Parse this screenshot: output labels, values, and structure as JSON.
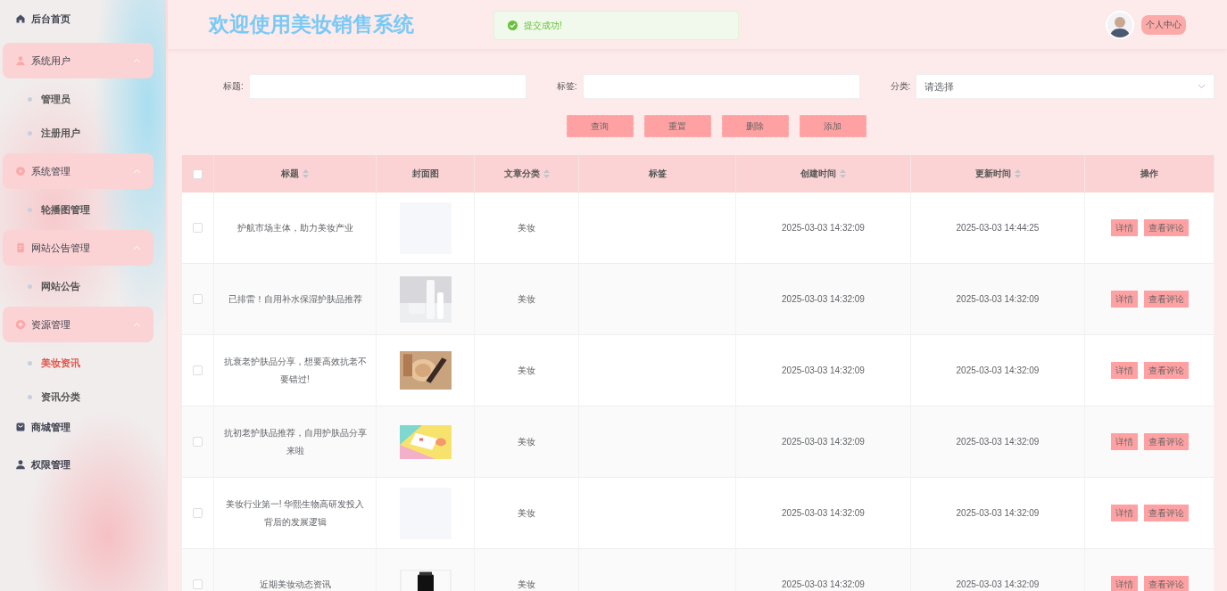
{
  "sidebar": {
    "items": [
      {
        "label": "后台首页",
        "expanded": false
      },
      {
        "label": "系统用户",
        "expanded": true,
        "children": [
          {
            "label": "管理员",
            "selected": false
          },
          {
            "label": "注册用户",
            "selected": false
          }
        ]
      },
      {
        "label": "系统管理",
        "expanded": true,
        "children": [
          {
            "label": "轮播图管理",
            "selected": false
          }
        ]
      },
      {
        "label": "网站公告管理",
        "expanded": true,
        "children": [
          {
            "label": "网站公告",
            "selected": false
          }
        ]
      },
      {
        "label": "资源管理",
        "expanded": true,
        "children": [
          {
            "label": "美妆资讯",
            "selected": true
          },
          {
            "label": "资讯分类",
            "selected": false
          }
        ]
      },
      {
        "label": "商城管理",
        "expanded": false
      },
      {
        "label": "权限管理",
        "expanded": false
      }
    ]
  },
  "header": {
    "title": "欢迎使用美妆销售系统",
    "toast": "提交成功!",
    "profile_button": "个人中心"
  },
  "filters": [
    {
      "label": "标题:",
      "kind": "input"
    },
    {
      "label": "标签:",
      "kind": "input"
    },
    {
      "label": "分类:",
      "kind": "select",
      "placeholder": "请选择"
    }
  ],
  "buttons": [
    "查询",
    "重置",
    "删除",
    "添加"
  ],
  "table": {
    "select_all": {
      "checked": false
    },
    "columns": [
      {
        "label": "标题",
        "sortable": true
      },
      {
        "label": "封面图",
        "sortable": false
      },
      {
        "label": "文章分类",
        "sortable": true
      },
      {
        "label": "标签",
        "sortable": false
      },
      {
        "label": "创建时间",
        "sortable": true
      },
      {
        "label": "更新时间",
        "sortable": true
      },
      {
        "label": "操作",
        "sortable": false
      }
    ],
    "rows": [
      {
        "checked": false,
        "title": "护航市场主体，助力美妆产业",
        "cover": {
          "kind": "empty"
        },
        "category": "美妆",
        "created": "2025-03-03 14:32:09",
        "updated": "2025-03-03 14:44:25",
        "actions": [
          "详情",
          "查看评论"
        ]
      },
      {
        "checked": false,
        "title": "已排雷！自用补水保湿护肤品推荐",
        "cover": {
          "kind": "picture"
        },
        "category": "美妆",
        "created": "2025-03-03 14:32:09",
        "updated": "2025-03-03 14:32:09",
        "actions": [
          "详情",
          "查看评论"
        ]
      },
      {
        "checked": false,
        "title": "抗衰老护肤品分享，想要高效抗老不要错过!",
        "cover": {
          "kind": "picture"
        },
        "category": "美妆",
        "created": "2025-03-03 14:32:09",
        "updated": "2025-03-03 14:32:09",
        "actions": [
          "详情",
          "查看评论"
        ]
      },
      {
        "checked": false,
        "title": "抗初老护肤品推荐，自用护肤品分享来啦",
        "cover": {
          "kind": "picture"
        },
        "category": "美妆",
        "created": "2025-03-03 14:32:09",
        "updated": "2025-03-03 14:32:09",
        "actions": [
          "详情",
          "查看评论"
        ]
      },
      {
        "checked": false,
        "title": "美妆行业第一! 华熙生物高研发投入背后的发展逻辑",
        "cover": {
          "kind": "empty"
        },
        "category": "美妆",
        "created": "2025-03-03 14:32:09",
        "updated": "2025-03-03 14:32:09",
        "actions": [
          "详情",
          "查看评论"
        ]
      },
      {
        "checked": false,
        "title": "近期美妆动态资讯",
        "cover": {
          "kind": "picture"
        },
        "category": "美妆",
        "created": "2025-03-03 14:32:09",
        "updated": "2025-03-03 14:32:09",
        "actions": [
          "详情",
          "查看评论"
        ]
      }
    ]
  }
}
